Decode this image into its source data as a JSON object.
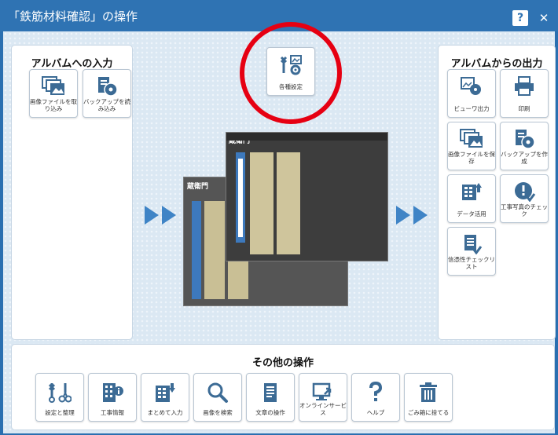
{
  "window": {
    "title": "「鉄筋材料確認」の操作",
    "help_label": "?",
    "close_label": "✕"
  },
  "input_panel": {
    "title": "アルバムへの入力",
    "buttons": [
      {
        "label": "画像ファイルを取り込み",
        "icon": "image-import-icon"
      },
      {
        "label": "バックアップを読み込み",
        "icon": "backup-load-icon"
      }
    ]
  },
  "settings_button": {
    "label": "各種設定",
    "icon": "settings-tools-icon"
  },
  "output_panel": {
    "title": "アルバムからの出力",
    "buttons": [
      {
        "label": "ビューワ出力",
        "icon": "viewer-output-icon"
      },
      {
        "label": "印刷",
        "icon": "printer-icon"
      },
      {
        "label": "画像ファイルを保存",
        "icon": "image-save-icon"
      },
      {
        "label": "バックアップを作成",
        "icon": "backup-create-icon"
      },
      {
        "label": "データ活用",
        "icon": "data-use-icon"
      },
      {
        "label": "工事写真のチェック",
        "icon": "photo-check-icon"
      },
      {
        "label": "信憑性チェックリスト",
        "icon": "checklist-icon"
      }
    ]
  },
  "other_panel": {
    "title": "その他の操作",
    "buttons": [
      {
        "label": "設定と整理",
        "icon": "tools-icon"
      },
      {
        "label": "工事情報",
        "icon": "construction-info-icon"
      },
      {
        "label": "まとめて入力",
        "icon": "batch-input-icon"
      },
      {
        "label": "画像を検索",
        "icon": "search-icon"
      },
      {
        "label": "文章の操作",
        "icon": "document-icon"
      },
      {
        "label": "オンラインサービス",
        "icon": "online-service-icon"
      },
      {
        "label": "ヘルプ",
        "icon": "help-icon"
      },
      {
        "label": "ごみ箱に捨てる",
        "icon": "trash-icon"
      }
    ]
  },
  "preview": {
    "logo_text": "蔵衛門"
  },
  "colors": {
    "accent": "#2f73b3",
    "highlight": "#e60012"
  }
}
